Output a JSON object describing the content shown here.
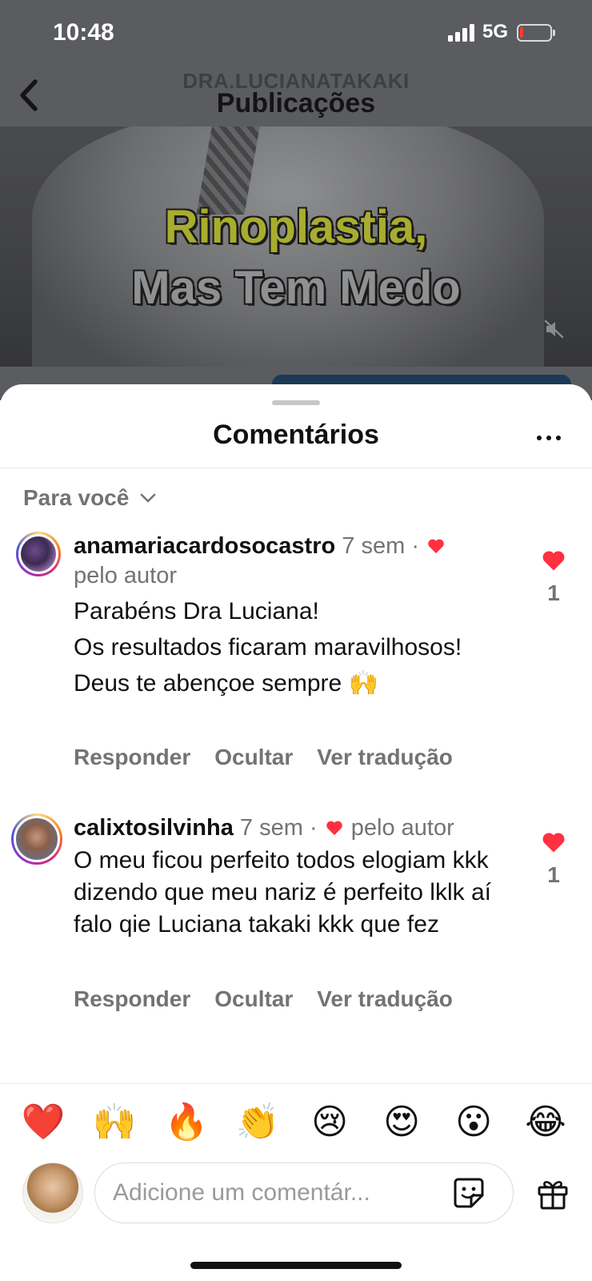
{
  "status_bar": {
    "time": "10:48",
    "network": "5G",
    "battery_level": 0.05
  },
  "header": {
    "account": "DRA.LUCIANATAKAKI",
    "title": "Publicações"
  },
  "video": {
    "line1": "Rinoplastia,",
    "line2": "Mas Tem Medo",
    "muted": true
  },
  "sheet": {
    "title": "Comentários",
    "sort_label": "Para você"
  },
  "comments": [
    {
      "username": "anamariacardosocastro",
      "time": "7 sem",
      "separator": "·",
      "liked_by_author": "pelo autor",
      "paragraphs": [
        "Parabéns Dra Luciana!",
        "Os resultados ficaram maravilhosos!",
        "Deus te abençoe sempre 🙌"
      ],
      "actions": [
        "Responder",
        "Ocultar",
        "Ver tradução"
      ],
      "likes": "1"
    },
    {
      "username": "calixtosilvinha",
      "time": "7 sem",
      "separator": "·",
      "liked_by_author": "pelo autor",
      "paragraphs": [
        "O meu ficou perfeito todos elogiam kkk dizendo que meu nariz é perfeito lklk aí falo qie Luciana takaki  kkk que fez"
      ],
      "actions": [
        "Responder",
        "Ocultar",
        "Ver tradução"
      ],
      "likes": "1"
    }
  ],
  "emoji_bar": [
    "❤️",
    "🙌",
    "🔥",
    "👏",
    "😢",
    "😍",
    "😮",
    "😂"
  ],
  "comment_input": {
    "placeholder": "Adicione um comentár..."
  },
  "icons": {
    "back": "chevron-left-icon",
    "mute": "speaker-muted-icon",
    "more": "more-horizontal-icon",
    "sort": "chevron-down-icon",
    "like": "heart-filled-icon",
    "sticker": "sticker-icon",
    "gift": "gift-icon"
  },
  "colors": {
    "like_red": "#ff3040",
    "secondary_text": "#737373",
    "video_title_yellow": "#a8ad2e"
  }
}
